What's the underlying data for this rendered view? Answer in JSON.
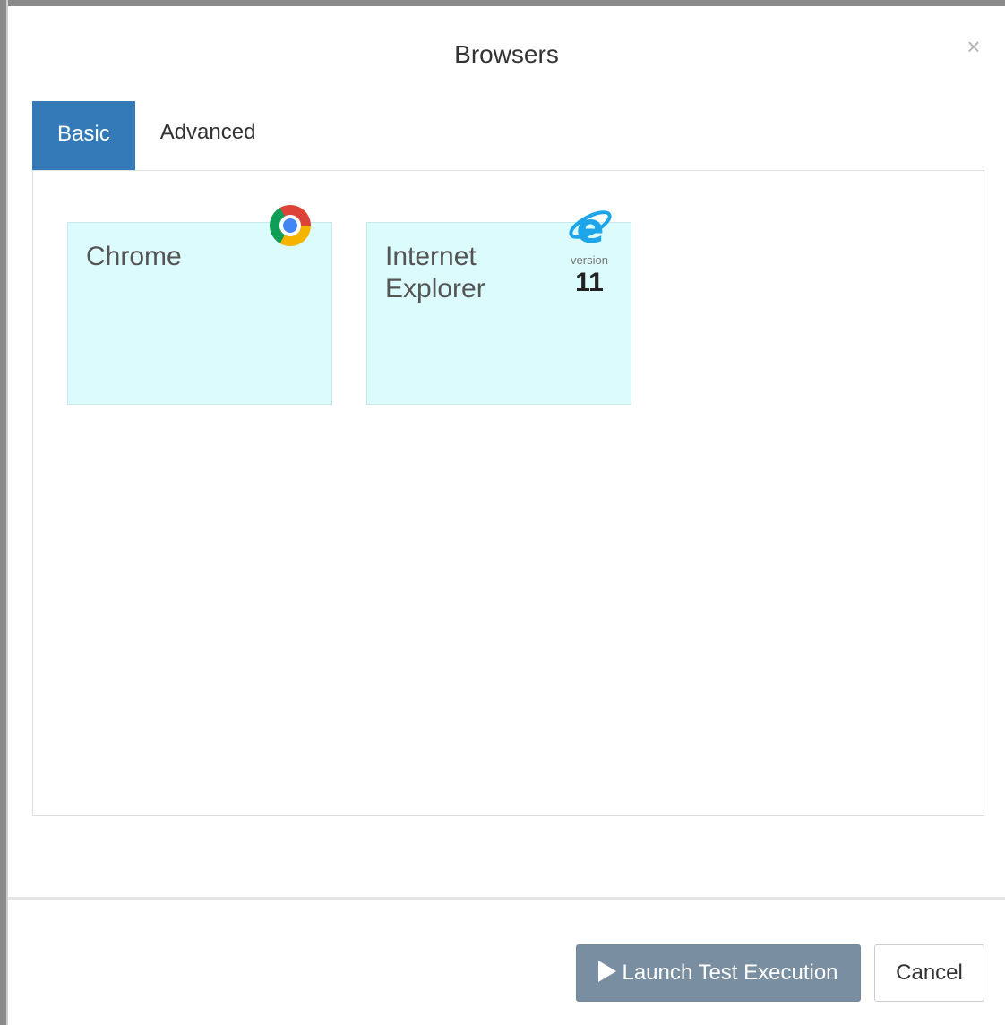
{
  "dialog": {
    "title": "Browsers",
    "close_label": "×"
  },
  "tabs": [
    {
      "label": "Basic",
      "active": true
    },
    {
      "label": "Advanced",
      "active": false
    }
  ],
  "browsers": [
    {
      "name_line1": "Chrome",
      "name_line2": "",
      "icon": "chrome-icon"
    },
    {
      "name_line1": "Internet",
      "name_line2": "Explorer",
      "icon": "ie-icon",
      "version_label": "version",
      "version": "11"
    }
  ],
  "footer": {
    "launch_label": "Launch Test Execution",
    "cancel_label": "Cancel"
  },
  "colors": {
    "accent": "#337ab7",
    "card_background": "#dcfbfc",
    "launch_button": "#7a8ea2",
    "ie_icon": "#1ea4e9"
  }
}
